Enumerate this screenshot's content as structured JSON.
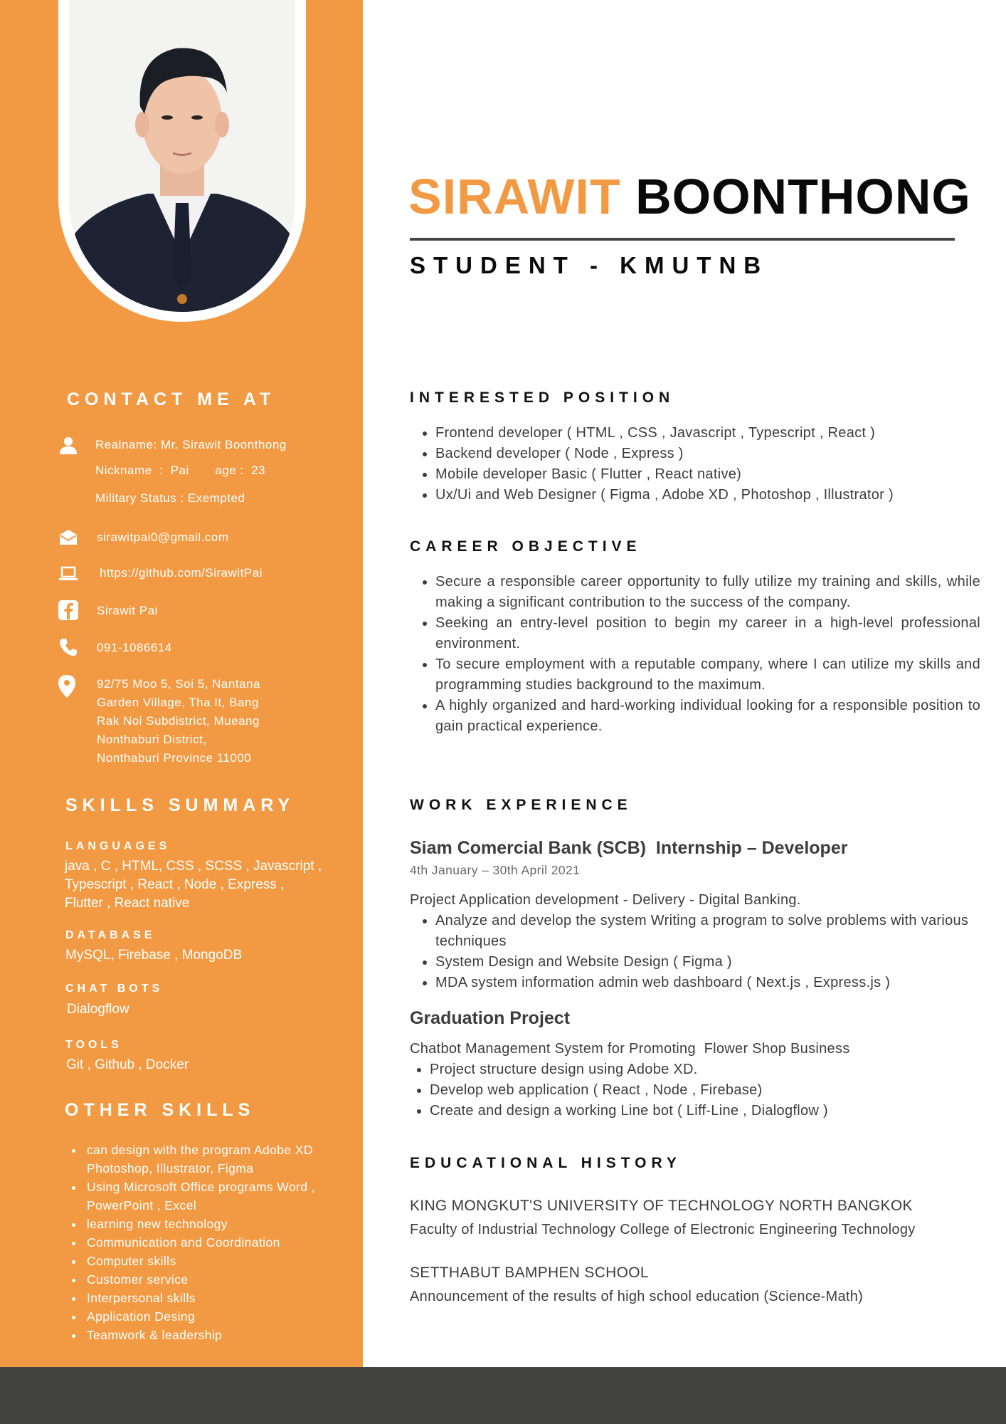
{
  "header": {
    "first_name": "SIRAWIT",
    "last_name": "BOONTHONG",
    "subtitle": "STUDENT - KMUTNB"
  },
  "colors": {
    "accent": "#f29a43",
    "footer": "#434341",
    "heading": "#111111",
    "text": "#3d3d3d"
  },
  "contact": {
    "title": "CONTACT ME AT",
    "realname": "Realname: Mr. Sirawit Boonthong",
    "nickname": "Nickname  :  Pai       age :  23",
    "military": "Military Status :  Exempted",
    "email": "sirawitpai0@gmail.com",
    "github": "https://github.com/SirawitPai",
    "facebook": "Sirawit Pai",
    "phone": "091-1086614",
    "address": [
      "92/75 Moo 5, Soi 5, Nantana",
      "Garden Village, Tha It, Bang",
      "Rak Noi Subdistrict, Mueang",
      "Nonthaburi District,",
      "Nonthaburi Province 11000"
    ],
    "icons": [
      "person-icon",
      "envelope-icon",
      "laptop-icon",
      "facebook-icon",
      "phone-icon",
      "location-pin-icon"
    ]
  },
  "skills": {
    "title": "SKILLS SUMMARY",
    "groups": [
      {
        "label": "LANGUAGES",
        "value": [
          "java , C  , HTML, CSS , SCSS , Javascript ,",
          "Typescript , React  , Node , Express ,",
          "Flutter   , React native"
        ]
      },
      {
        "label": "DATABASE",
        "value": [
          "MySQL, Firebase , MongoDB"
        ]
      },
      {
        "label": "CHAT BOTS",
        "value": [
          "Dialogflow"
        ]
      },
      {
        "label": "TOOLS",
        "value": [
          "Git , Github , Docker"
        ]
      }
    ]
  },
  "other_skills": {
    "title": "OTHER SKILLS",
    "items": [
      "can design with the program Adobe XD Photoshop, Illustrator, Figma",
      "Using Microsoft Office programs  Word , PowerPoint , Excel",
      "learning new technology",
      "Communication and Coordination",
      "Computer skills",
      "Customer service",
      "Interpersonal skills",
      "Application Desing",
      "Teamwork & leadership"
    ]
  },
  "interested_position": {
    "title": "INTERESTED POSITION",
    "items": [
      "Frontend  developer ( HTML , CSS , Javascript , Typescript , React  )",
      "Backend   developer  (  Node , Express  )",
      "Mobile developer  Basic ( Flutter , React native)",
      "Ux/Ui and Web Designer ( Figma , Adobe XD ,  Photoshop , Illustrator )"
    ]
  },
  "career_objective": {
    "title": "CAREER OBJECTIVE",
    "items": [
      "Secure a responsible career opportunity to fully utilize my training and skills, while making a significant contribution to the success of the company.",
      "Seeking an entry-level position to begin my career in a high-level professional environment.",
      "To secure employment with a reputable company, where I can utilize my skills and programming studies background to the maximum.",
      "A highly organized and hard-working individual looking for a responsible position to gain practical experience."
    ]
  },
  "work_experience": {
    "title": "WORK EXPERIENCE",
    "job_title": "Siam Comercial Bank (SCB)  Internship – Developer",
    "job_dates": "4th January – 30th April 2021",
    "job_desc": "Project Application development - Delivery - Digital Banking.",
    "job_items": [
      "Analyze and develop the system Writing a program to solve problems with various techniques",
      "System Design and Website Design ( Figma )",
      "MDA system information admin web dashboard ( Next.js , Express.js  )"
    ],
    "project_title": "Graduation Project",
    "project_desc": "Chatbot Management System for Promoting  Flower Shop Business",
    "project_items": [
      "Project structure design using Adobe XD.",
      "Develop web application ( React  , Node , Firebase)",
      "Create and design a working Line bot ( Liff-Line , Dialogflow )"
    ]
  },
  "education": {
    "title": "EDUCATIONAL HISTORY",
    "entries": [
      {
        "school": "KING MONGKUT'S UNIVERSITY OF TECHNOLOGY NORTH BANGKOK",
        "detail": "Faculty of Industrial Technology College of Electronic Engineering Technology"
      },
      {
        "school": "SETTHABUT BAMPHEN SCHOOL",
        "detail": "Announcement of the results of high school education (Science-Math)"
      }
    ]
  }
}
